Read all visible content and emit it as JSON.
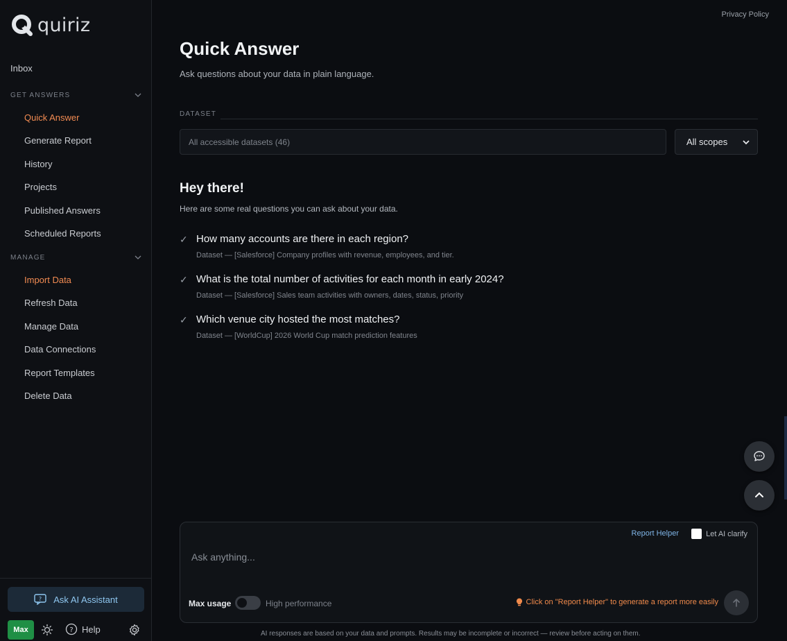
{
  "app": {
    "logo_text": "quiriz",
    "privacy_link": "Privacy Policy"
  },
  "sidebar": {
    "inbox": "Inbox",
    "sections": [
      {
        "header": "GET ANSWERS",
        "items": [
          "Quick Answer",
          "Generate Report",
          "History",
          "Projects",
          "Published Answers",
          "Scheduled Reports"
        ]
      },
      {
        "header": "MANAGE",
        "items": [
          "Import Data",
          "Refresh Data",
          "Manage Data",
          "Data Connections",
          "Report Templates",
          "Delete Data"
        ]
      }
    ],
    "ask_ai_label": "Ask AI Assistant",
    "user_badge": "Max",
    "help_label": "Help"
  },
  "main": {
    "title": "Quick Answer",
    "subtitle": "Ask questions about your data in plain language.",
    "dataset_label": "DATASET",
    "dataset_placeholder": "All accessible datasets (46)",
    "scope_value": "All scopes",
    "greeting": "Hey there!",
    "greeting_sub": "Here are some real questions you can ask about your data.",
    "questions": [
      {
        "text": "How many accounts are there in each region?",
        "meta": "Dataset — [Salesforce] Company profiles with revenue, employees, and tier."
      },
      {
        "text": "What is the total number of activities for each month in early 2024?",
        "meta": "Dataset — [Salesforce] Sales team activities with owners, dates, status, priority"
      },
      {
        "text": "Which venue city hosted the most matches?",
        "meta": "Dataset — [WorldCup] 2026 World Cup match prediction features"
      }
    ],
    "check_glyph": "✓"
  },
  "composer": {
    "report_helper": "Report Helper",
    "clarify_label": "Let AI clarify",
    "placeholder": "Ask anything...",
    "max_usage": "Max usage",
    "high_performance": "High performance",
    "hint": "Click on \"Report Helper\" to generate a report more easily"
  },
  "disclaimer": "AI responses are based on your data and prompts. Results may be incomplete or incorrect — review before acting on them.",
  "colors": {
    "accent": "#f28b52",
    "link": "#7fb4e6",
    "badge": "#1f8f45",
    "background": "#0b0d11"
  }
}
